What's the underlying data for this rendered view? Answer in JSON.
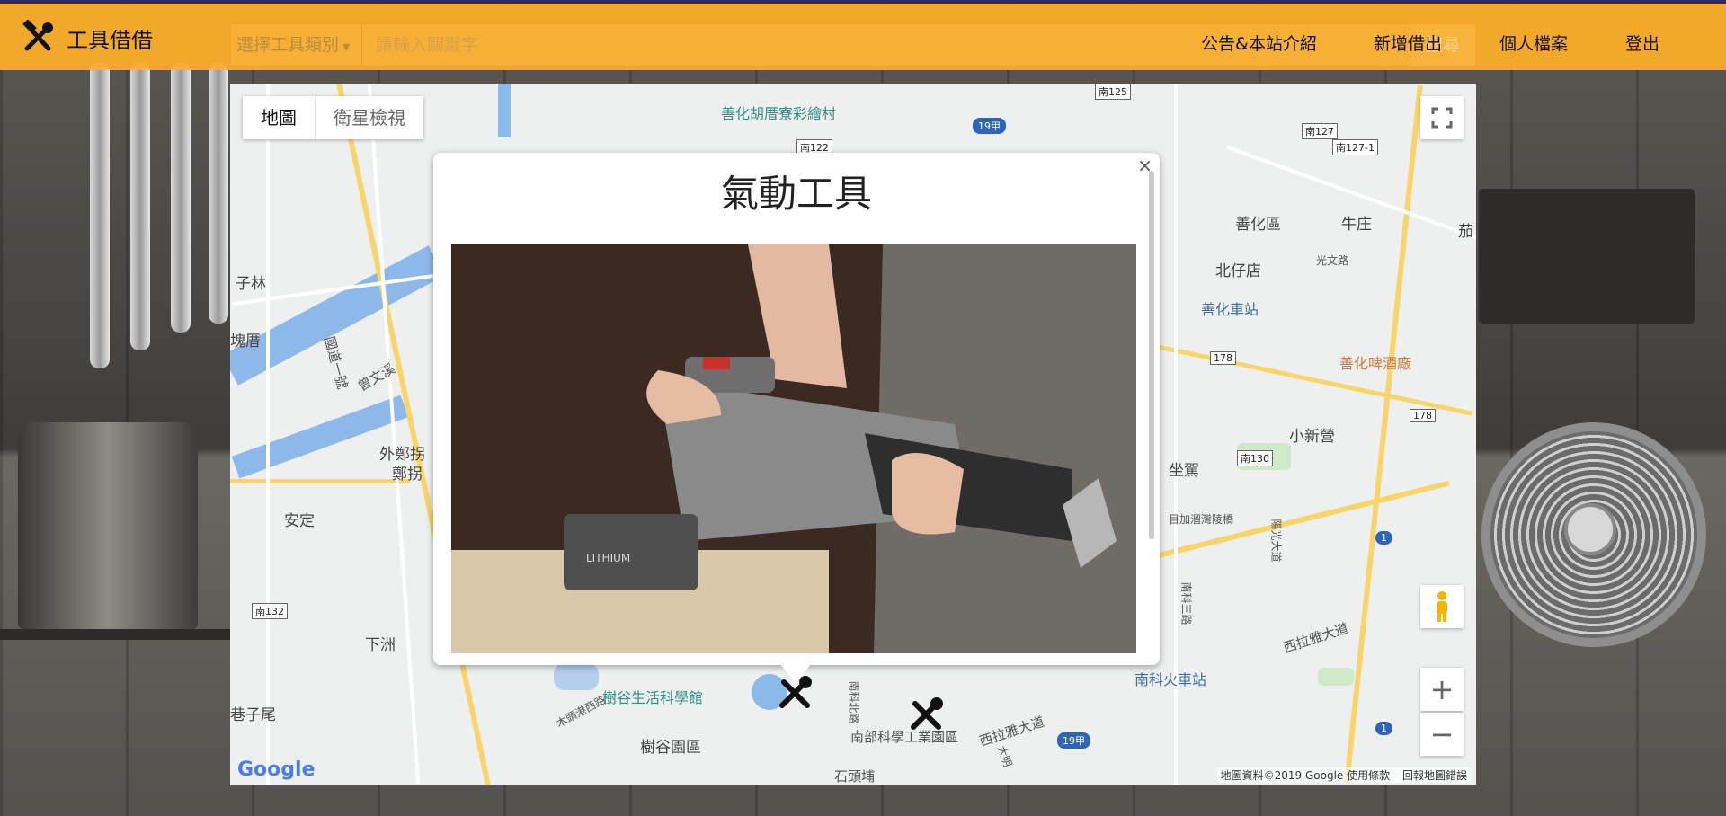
{
  "header": {
    "logo_text": "工具借借",
    "category_label": "選擇工具類別",
    "search_placeholder": "請輸入關鍵字",
    "search_button": "搜尋",
    "nav": [
      "公告&本站介紹",
      "新增借出",
      "個人檔案",
      "登出"
    ]
  },
  "map": {
    "type_map": "地圖",
    "type_satellite": "衛星檢視",
    "zoom_in": "+",
    "zoom_out": "−",
    "google": "Google",
    "attribution": "地圖資料©2019 Google",
    "terms": "使用條款",
    "report": "回報地圖錯誤",
    "labels": {
      "shanhua_hulu": "善化胡厝寮彩繪村",
      "shanhua_district": "善化區",
      "niuzhuang": "牛庄",
      "beizaidian": "北仔店",
      "guangwen_rd": "光文路",
      "shanhua_station": "善化車站",
      "shanhua_brewery": "善化啤酒廠",
      "xiaoxinying": "小新營",
      "zuojia": "坐駕",
      "muyang": "目加溜灣陵橋",
      "yangguang": "陽光大道",
      "xilaya_1": "西拉雅大道",
      "xilaya_2": "西拉雅大道",
      "nanke_station": "南科火車站",
      "shugu_museum": "樹谷生活科學館",
      "shugu_park": "樹谷園區",
      "science_park": "南部科學工業園區",
      "zilin": "子林",
      "kuaicuo": "塊厝",
      "waizheng": "外鄭拐",
      "zhengguai": "鄭拐",
      "anding": "安定",
      "xiazhou": "下洲",
      "xiangziwei": "巷子尾",
      "zengwen": "曾文溪",
      "freeway": "國道一號",
      "nanke_n_rd": "南科北路",
      "nanke_3rd": "南科三路",
      "mutoujian": "木頭港西路",
      "jia": "茄",
      "shitou": "石頭埔",
      "daming": "大明"
    },
    "routes": [
      "南125",
      "南127",
      "南127-1",
      "南122",
      "19甲",
      "178",
      "178",
      "南130",
      "1",
      "1",
      "南132",
      "19甲"
    ]
  },
  "infowindow": {
    "title": "氣動工具",
    "close": "×",
    "photo_brand": "LITHIUM"
  },
  "colors": {
    "header": "#ffb028",
    "accent_road": "#f8d56a",
    "water": "#8db8ea"
  }
}
